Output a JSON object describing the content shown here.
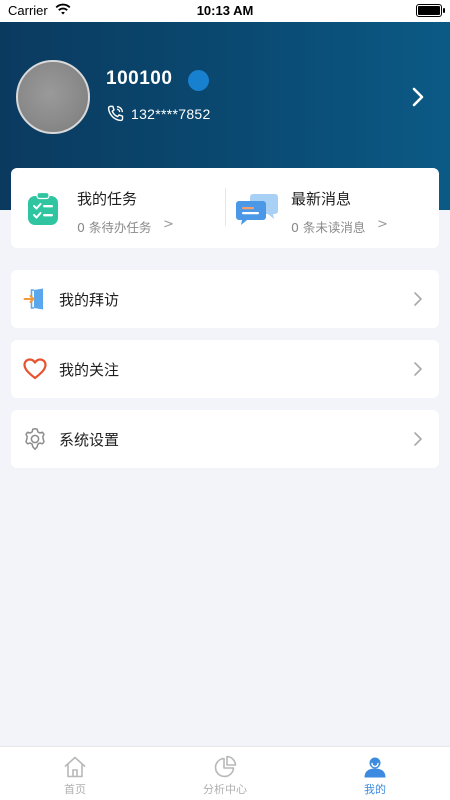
{
  "status_bar": {
    "carrier": "Carrier",
    "time": "10:13 AM"
  },
  "profile": {
    "username": "100100",
    "phone": "132****7852"
  },
  "summary": {
    "tasks": {
      "title": "我的任务",
      "subtitle": "0 条待办任务",
      "chevron": ">"
    },
    "messages": {
      "title": "最新消息",
      "subtitle": "0 条未读消息",
      "chevron": ">"
    }
  },
  "menu": {
    "items": [
      {
        "label": "我的拜访",
        "icon": "visit-icon"
      },
      {
        "label": "我的关注",
        "icon": "heart-icon"
      },
      {
        "label": "系统设置",
        "icon": "gear-icon"
      }
    ]
  },
  "tabbar": {
    "tabs": [
      {
        "label": "首页",
        "icon": "home-icon"
      },
      {
        "label": "分析中心",
        "icon": "pie-chart-icon"
      },
      {
        "label": "我的",
        "icon": "user-icon"
      }
    ],
    "active_index": 2
  },
  "colors": {
    "header_start": "#0b3a5f",
    "header_end": "#0b5a86",
    "accent": "#3d8be0",
    "task_green": "#2fc5a1",
    "heart_red": "#e8532f"
  }
}
